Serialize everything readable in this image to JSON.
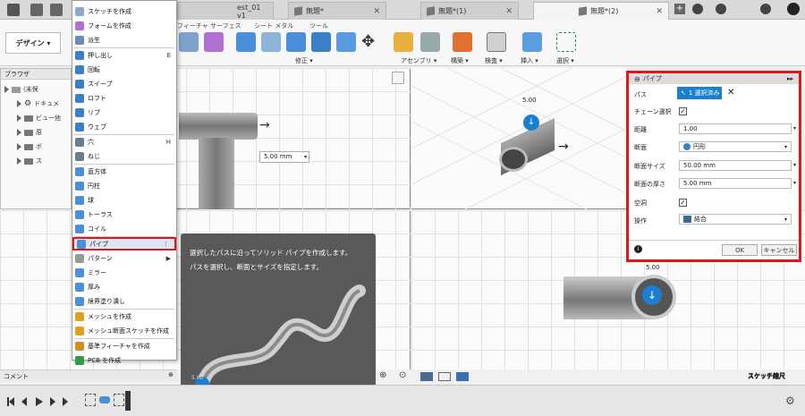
{
  "tabs": [
    {
      "label": "est_01 v1",
      "active": false
    },
    {
      "label": "無題*",
      "active": false
    },
    {
      "label": "無題*(1)",
      "active": false
    },
    {
      "label": "無題*(2)",
      "active": true
    }
  ],
  "ribbon": {
    "workspace_button": "デザイン ▾",
    "tab_labels": [
      "フィーチャ サーフェス",
      "シート メタル",
      "ツール"
    ],
    "group_labels": [
      "修正 ▾",
      "アセンブリ ▾",
      "構築 ▾",
      "検査 ▾",
      "挿入 ▾",
      "選択 ▾"
    ]
  },
  "browser": {
    "title": "ブラウザ",
    "items": [
      "(未保",
      "ドキュメ",
      "ビュー他",
      "原",
      "ボ",
      "ス"
    ]
  },
  "menu": {
    "items": [
      {
        "label": "スケッチを作成",
        "shortcut": "",
        "color": "#8da8c8"
      },
      {
        "label": "フォームを作成",
        "shortcut": "",
        "color": "#b070d0"
      },
      {
        "label": "派生",
        "shortcut": "",
        "color": "#6a8bb5"
      },
      {
        "label": "押し出し",
        "shortcut": "E",
        "color": "#3a7fc8"
      },
      {
        "label": "回転",
        "shortcut": "",
        "color": "#3a7fc8"
      },
      {
        "label": "スイープ",
        "shortcut": "",
        "color": "#3a7fc8"
      },
      {
        "label": "ロフト",
        "shortcut": "",
        "color": "#3a7fc8"
      },
      {
        "label": "リブ",
        "shortcut": "",
        "color": "#3a7fc8"
      },
      {
        "label": "ウェブ",
        "shortcut": "",
        "color": "#3a7fc8"
      },
      {
        "label": "穴",
        "shortcut": "H",
        "color": "#6a7c90"
      },
      {
        "label": "ねじ",
        "shortcut": "",
        "color": "#6a7c90"
      },
      {
        "label": "直方体",
        "shortcut": "",
        "color": "#4a8fd8"
      },
      {
        "label": "円柱",
        "shortcut": "",
        "color": "#4a8fd8"
      },
      {
        "label": "球",
        "shortcut": "",
        "color": "#4a8fd8"
      },
      {
        "label": "トーラス",
        "shortcut": "",
        "color": "#4a8fd8"
      },
      {
        "label": "コイル",
        "shortcut": "",
        "color": "#4a8fd8"
      },
      {
        "label": "パイプ",
        "shortcut": "⋮",
        "color": "#4a8fd8"
      },
      {
        "label": "パターン",
        "shortcut": "▶",
        "color": "#999999"
      },
      {
        "label": "ミラー",
        "shortcut": "",
        "color": "#4a8fd8"
      },
      {
        "label": "厚み",
        "shortcut": "",
        "color": "#4a8fd8"
      },
      {
        "label": "境界塗り潰し",
        "shortcut": "",
        "color": "#4a8fd8"
      },
      {
        "label": "メッシュを作成",
        "shortcut": "",
        "color": "#e0a020"
      },
      {
        "label": "メッシュ断面スケッチを作成",
        "shortcut": "",
        "color": "#e0a020"
      },
      {
        "label": "基準フィーチャを作成",
        "shortcut": "",
        "color": "#d09020"
      },
      {
        "label": "PCB を作成",
        "shortcut": "",
        "color": "#2f9a4a"
      }
    ]
  },
  "tooltip": {
    "line1": "選択したパスに沿ってソリッド パイプを作成します。",
    "line2": "パスを選択し、断面とサイズを指定します。",
    "dim": "5.00"
  },
  "viewport": {
    "dim_input": "5.00 mm",
    "dim_label_top": "5.00",
    "dim_label_bottom": "5.00",
    "sketch_scale": "スケッチ縮尺"
  },
  "panel": {
    "title": "パイプ",
    "path_label": "パス",
    "path_value": "1 選択済み",
    "chain_label": "チェーン選択",
    "chain_checked": true,
    "distance_label": "距離",
    "distance_value": "1.00",
    "section_label": "断面",
    "section_value": "円形",
    "size_label": "断面サイズ",
    "size_value": "50.00 mm",
    "thickness_label": "断面の厚さ",
    "thickness_value": "5.00 mm",
    "hollow_label": "空洞",
    "hollow_checked": true,
    "operation_label": "操作",
    "operation_value": "結合",
    "ok": "OK",
    "cancel": "キャンセル"
  },
  "comment": {
    "label": "コメント"
  },
  "colors": {
    "highlight": "#e0161c",
    "accent": "#1a7fd0"
  }
}
